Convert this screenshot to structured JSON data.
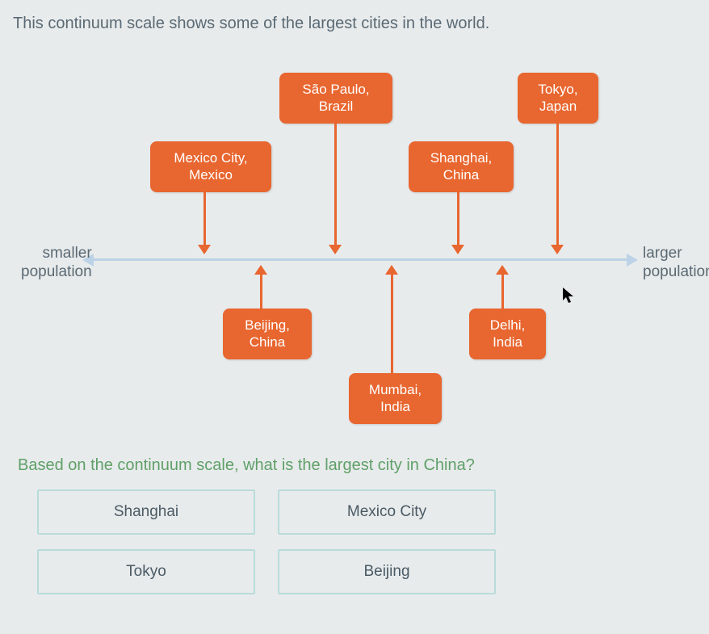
{
  "intro": "This continuum scale shows some of the largest cities in the world.",
  "axis": {
    "left": "smaller\npopulation",
    "right": "larger\npopulation"
  },
  "cities": {
    "mexico": {
      "line1": "Mexico City,",
      "line2": "Mexico"
    },
    "saopaulo": {
      "line1": "São Paulo,",
      "line2": "Brazil"
    },
    "shanghai": {
      "line1": "Shanghai,",
      "line2": "China"
    },
    "tokyo": {
      "line1": "Tokyo,",
      "line2": "Japan"
    },
    "beijing": {
      "line1": "Beijing,",
      "line2": "China"
    },
    "mumbai": {
      "line1": "Mumbai,",
      "line2": "India"
    },
    "delhi": {
      "line1": "Delhi,",
      "line2": "India"
    }
  },
  "question": "Based on the continuum scale, what is the largest city in China?",
  "answers": {
    "a1": "Shanghai",
    "a2": "Mexico City",
    "a3": "Tokyo",
    "a4": "Beijing"
  },
  "chart_data": {
    "type": "continuum",
    "axis": {
      "left": "smaller population",
      "right": "larger population"
    },
    "items_in_order_small_to_large": [
      "Mexico City, Mexico",
      "Beijing, China",
      "São Paulo, Brazil",
      "Mumbai, India",
      "Shanghai, China",
      "Delhi, India",
      "Tokyo, Japan"
    ]
  }
}
